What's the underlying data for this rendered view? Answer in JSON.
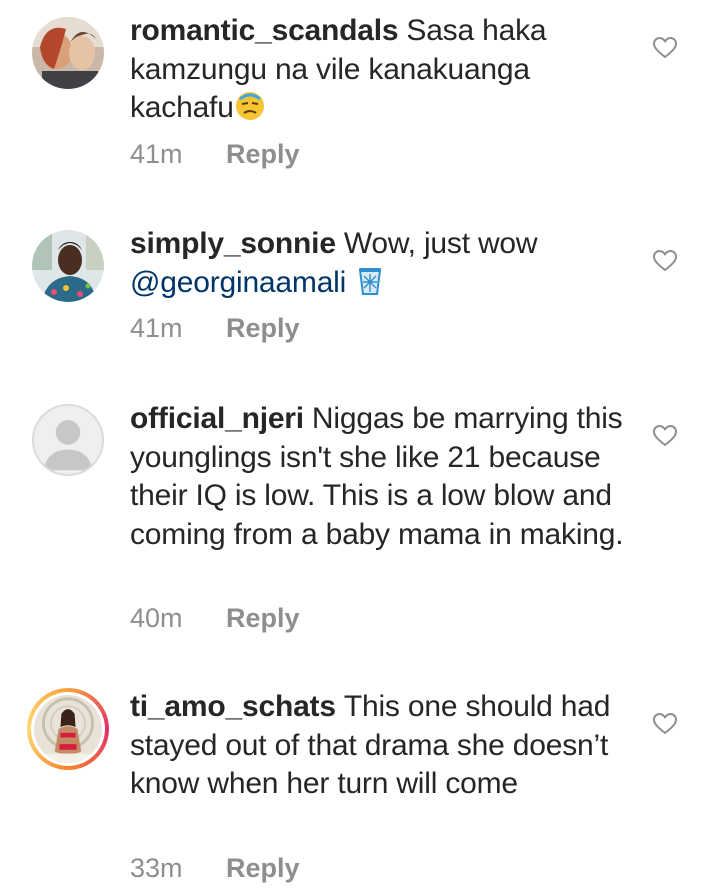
{
  "comments": [
    {
      "username": "romantic_scandals",
      "text": "Sasa haka kamzungu na vile kanakuanga kachafu",
      "emoji": "unamused-face-emoji",
      "time": "41m",
      "reply_label": "Reply"
    },
    {
      "username": "simply_sonnie",
      "text": "Wow, just wow",
      "mention": "@georginaamali",
      "emoji": "wastebasket-emoji",
      "time": "41m",
      "reply_label": "Reply"
    },
    {
      "username": "official_njeri",
      "text": "Niggas be marrying this younglings isn't she like 21 because their IQ is low. This is a low blow and coming from a baby mama in making.",
      "time": "40m",
      "reply_label": "Reply"
    },
    {
      "username": "ti_amo_schats",
      "text": "This one should had stayed out of that drama she doesn’t know when her turn will come",
      "time": "33m",
      "reply_label": "Reply"
    }
  ],
  "icons": {
    "like": "heart-outline-icon",
    "default_avatar": "default-avatar-icon"
  },
  "colors": {
    "text": "#262626",
    "secondary": "#8e8e8e",
    "mention": "#003569",
    "story_ring": "#e1306c"
  }
}
